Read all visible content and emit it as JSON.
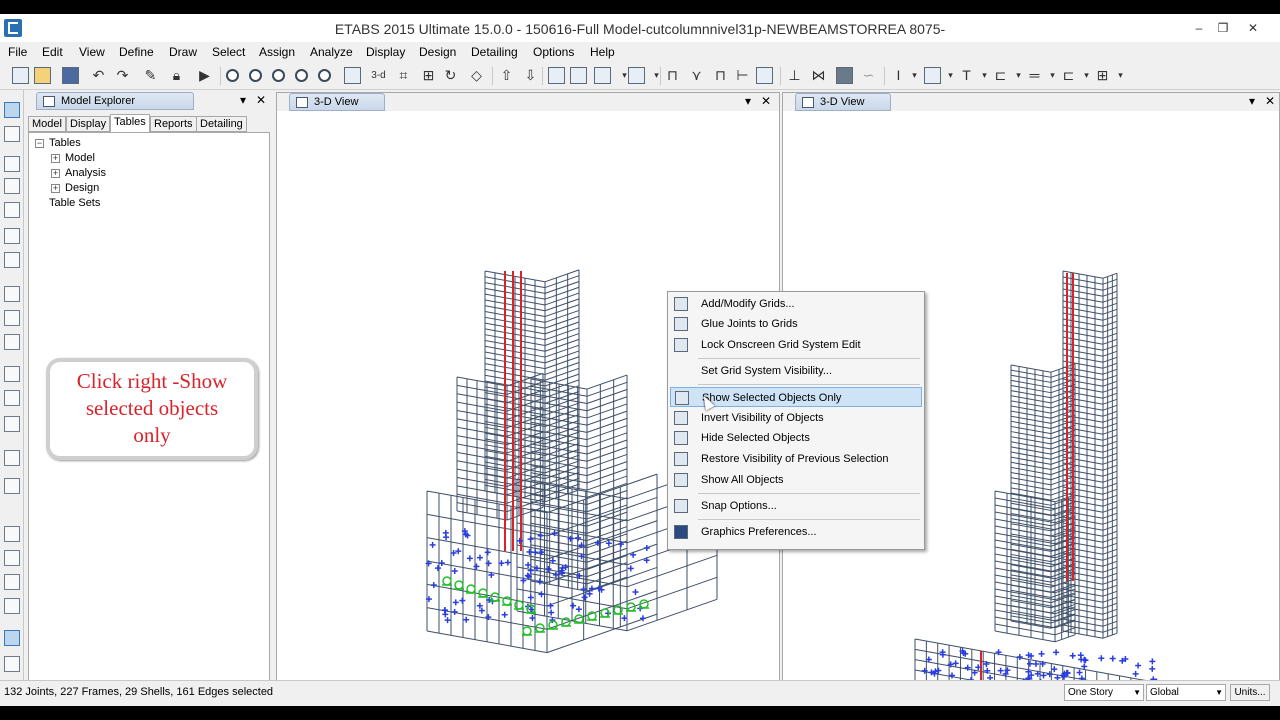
{
  "window": {
    "title": "ETABS 2015 Ultimate 15.0.0 - 150616-Full Model-cutcolumnnivel31p-NEWBEAMSTORREA 8075-",
    "minimize": "–",
    "maximize": "❐",
    "close": "✕"
  },
  "menu": [
    "File",
    "Edit",
    "View",
    "Define",
    "Draw",
    "Select",
    "Assign",
    "Analyze",
    "Display",
    "Design",
    "Detailing",
    "Options",
    "Help"
  ],
  "explorer": {
    "title": "Model Explorer",
    "pin": "▾",
    "close": "✕",
    "tabs": [
      "Model",
      "Display",
      "Tables",
      "Reports",
      "Detailing"
    ],
    "active_tab": "Tables",
    "tree": {
      "root": "Tables",
      "children": [
        "Model",
        "Analysis",
        "Design"
      ],
      "sibling": "Table Sets"
    }
  },
  "callout": {
    "line1": "Click right -Show",
    "line2": "selected objects",
    "line3": "only"
  },
  "views": {
    "left": {
      "title": "3-D View",
      "pin": "▾",
      "close": "✕"
    },
    "right": {
      "title": "3-D View",
      "pin": "▾",
      "close": "✕"
    }
  },
  "context_menu": {
    "items": [
      {
        "label": "Add/Modify Grids...",
        "icon": "grid-icon"
      },
      {
        "label": "Glue Joints to Grids",
        "icon": "glue-joint-icon"
      },
      {
        "label": "Lock Onscreen Grid System Edit",
        "icon": "lock-grid-icon"
      },
      {
        "label": "Set Grid System Visibility...",
        "icon": ""
      },
      {
        "label": "Show Selected Objects Only",
        "icon": "show-selected-icon"
      },
      {
        "label": "Invert Visibility of Objects",
        "icon": "invert-visibility-icon"
      },
      {
        "label": "Hide Selected Objects",
        "icon": "hide-selected-icon"
      },
      {
        "label": "Restore Visibility of Previous Selection",
        "icon": "restore-visibility-icon"
      },
      {
        "label": "Show All Objects",
        "icon": "show-all-icon"
      },
      {
        "label": "Snap Options...",
        "icon": "snap-icon"
      },
      {
        "label": "Graphics Preferences...",
        "icon": "graphics-icon"
      }
    ],
    "highlighted": "Show Selected Objects Only"
  },
  "status": {
    "text": "132 Joints, 227 Frames, 29 Shells, 161 Edges selected",
    "story": "One Story",
    "coord": "Global",
    "units": "Units..."
  },
  "colors": {
    "frame": "#3e4f68",
    "column_selected": "#d8232a",
    "support": "#22c026",
    "joint_selected": "#2a3ee0",
    "highlight": "#cfe3f7"
  }
}
